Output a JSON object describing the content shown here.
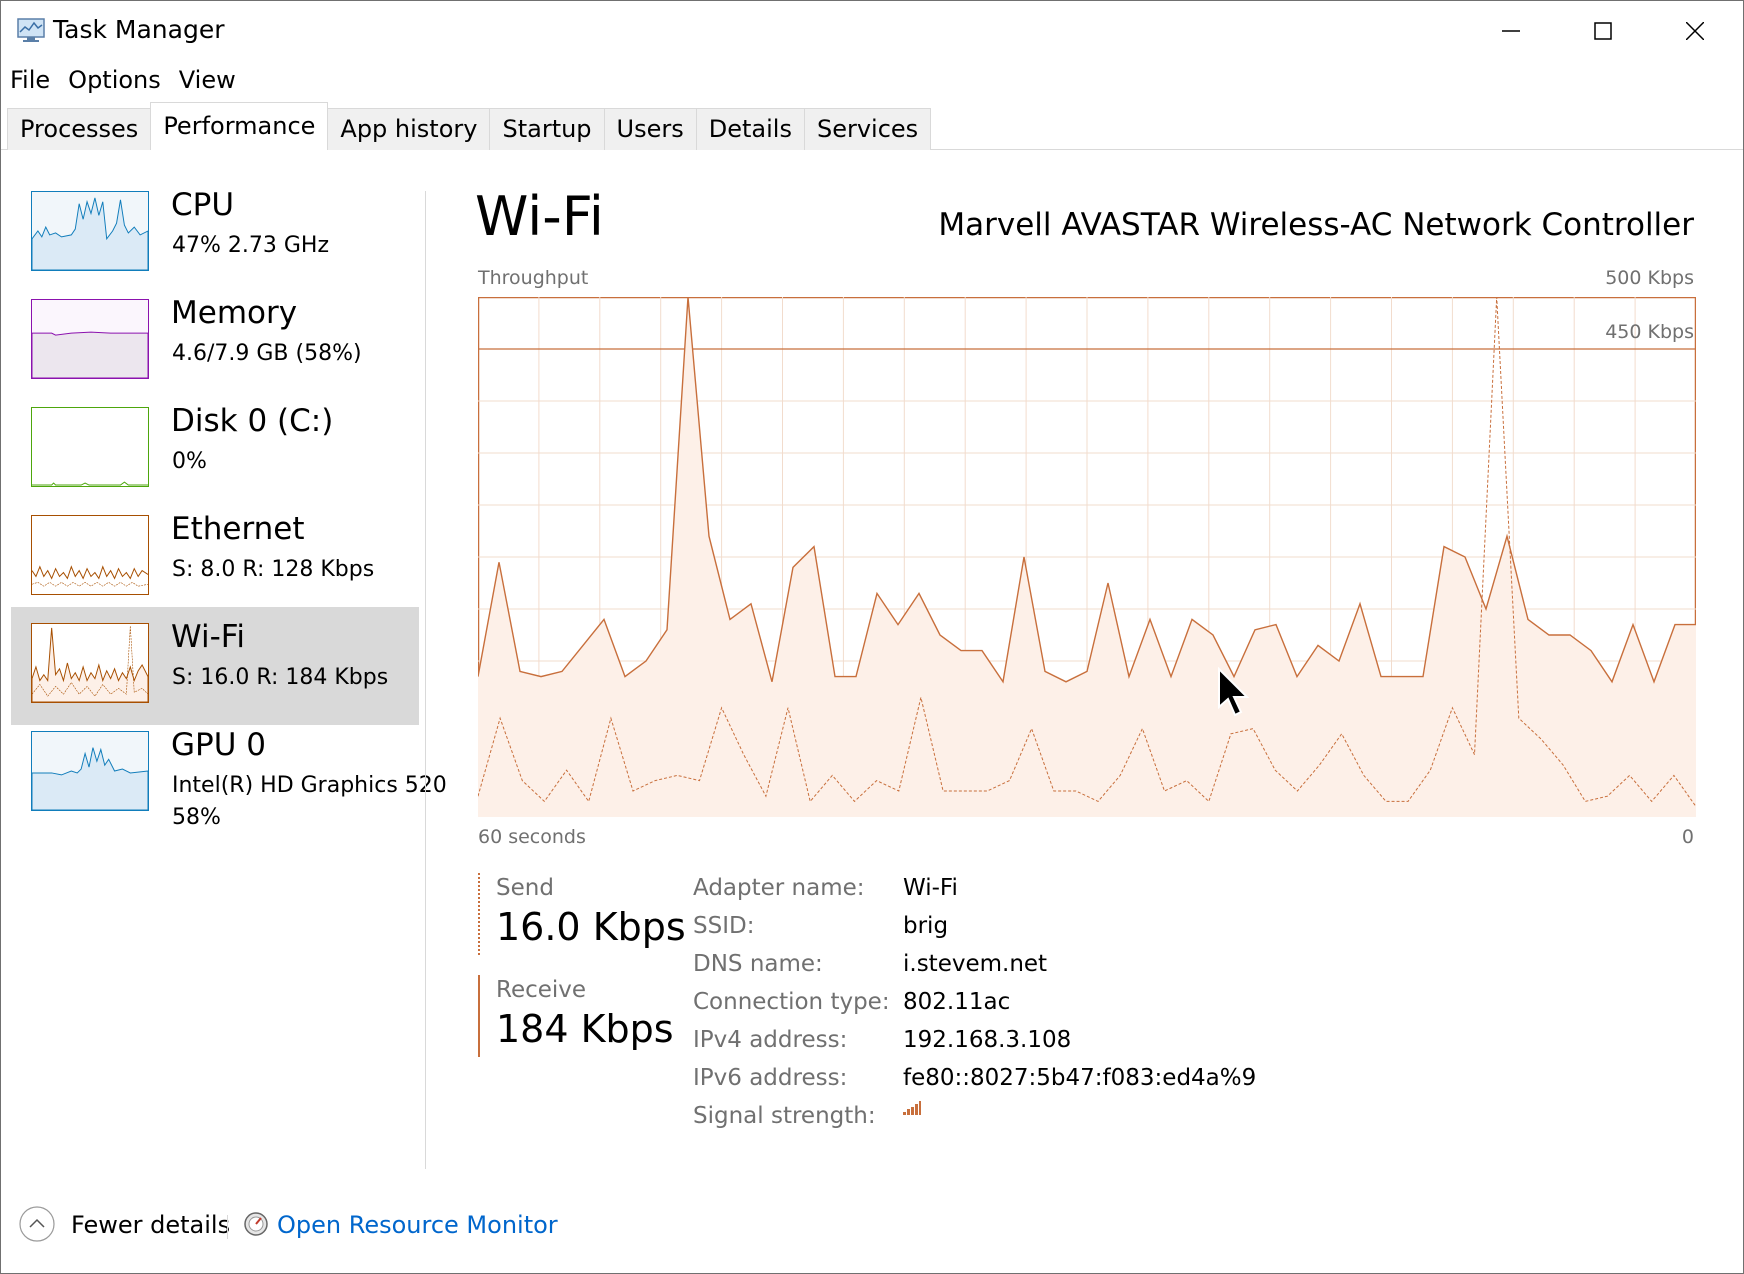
{
  "window": {
    "title": "Task Manager"
  },
  "menu": [
    "File",
    "Options",
    "View"
  ],
  "tabs": [
    "Processes",
    "Performance",
    "App history",
    "Startup",
    "Users",
    "Details",
    "Services"
  ],
  "active_tab": "Performance",
  "sidebar": {
    "items": [
      {
        "name": "CPU",
        "stat": "47%  2.73 GHz",
        "color": "#117dbb"
      },
      {
        "name": "Memory",
        "stat": "4.6/7.9 GB (58%)",
        "color": "#8b12ae"
      },
      {
        "name": "Disk 0 (C:)",
        "stat": "0%",
        "color": "#4da60c"
      },
      {
        "name": "Ethernet",
        "stat": "S: 8.0  R: 128 Kbps",
        "color": "#a74f01"
      },
      {
        "name": "Wi-Fi",
        "stat": "S: 16.0  R: 184 Kbps",
        "color": "#a74f01"
      },
      {
        "name": "GPU 0",
        "stat": "Intel(R) HD Graphics 520",
        "stat2": "58%",
        "color": "#117dbb"
      }
    ],
    "selected": "Wi-Fi"
  },
  "main": {
    "title": "Wi-Fi",
    "adapter_description": "Marvell AVASTAR Wireless-AC Network Controller",
    "graph": {
      "label": "Throughput",
      "max_label": "500 Kbps",
      "scale_label": "450 Kbps",
      "x_left": "60 seconds",
      "x_right": "0"
    },
    "send": {
      "label": "Send",
      "value": "16.0 Kbps"
    },
    "receive": {
      "label": "Receive",
      "value": "184 Kbps"
    },
    "details": [
      {
        "label": "Adapter name:",
        "value": "Wi-Fi"
      },
      {
        "label": "SSID:",
        "value": "brig"
      },
      {
        "label": "DNS name:",
        "value": "i.stevem.net"
      },
      {
        "label": "Connection type:",
        "value": "802.11ac"
      },
      {
        "label": "IPv4 address:",
        "value": "192.168.3.108"
      },
      {
        "label": "IPv6 address:",
        "value": "fe80::8027:5b47:f083:ed4a%9"
      },
      {
        "label": "Signal strength:",
        "value": ""
      }
    ]
  },
  "footer": {
    "fewer_details": "Fewer details",
    "open_resource_monitor": "Open Resource Monitor"
  },
  "colors": {
    "accent_network": "#c86f3c",
    "graph_fill": "#fdf0e8",
    "grid": "#f2dccd",
    "link": "#0066cc",
    "selected_bg": "#d9d9d9"
  },
  "chart_data": {
    "type": "area",
    "ylabel": "Throughput",
    "ylim": [
      0,
      500
    ],
    "y_unit": "Kbps",
    "x_range_seconds": [
      60,
      0
    ],
    "series": [
      {
        "name": "Receive",
        "values": [
          135,
          245,
          140,
          135,
          140,
          165,
          190,
          135,
          150,
          180,
          500,
          270,
          190,
          205,
          130,
          240,
          260,
          135,
          135,
          215,
          185,
          215,
          175,
          160,
          160,
          130,
          250,
          140,
          130,
          140,
          225,
          135,
          190,
          135,
          190,
          175,
          135,
          180,
          185,
          135,
          165,
          150,
          205,
          135,
          135,
          135,
          260,
          250,
          200,
          270,
          190,
          175,
          175,
          160,
          130,
          185,
          130,
          185,
          185
        ]
      },
      {
        "name": "Send",
        "values": [
          20,
          95,
          35,
          15,
          45,
          15,
          95,
          25,
          35,
          40,
          35,
          105,
          60,
          20,
          105,
          15,
          40,
          15,
          35,
          25,
          115,
          25,
          25,
          25,
          35,
          85,
          25,
          25,
          15,
          40,
          85,
          25,
          35,
          15,
          80,
          85,
          45,
          25,
          50,
          80,
          40,
          15,
          15,
          45,
          105,
          60,
          500,
          95,
          75,
          50,
          15,
          20,
          40,
          15,
          40,
          10
        ]
      }
    ]
  }
}
